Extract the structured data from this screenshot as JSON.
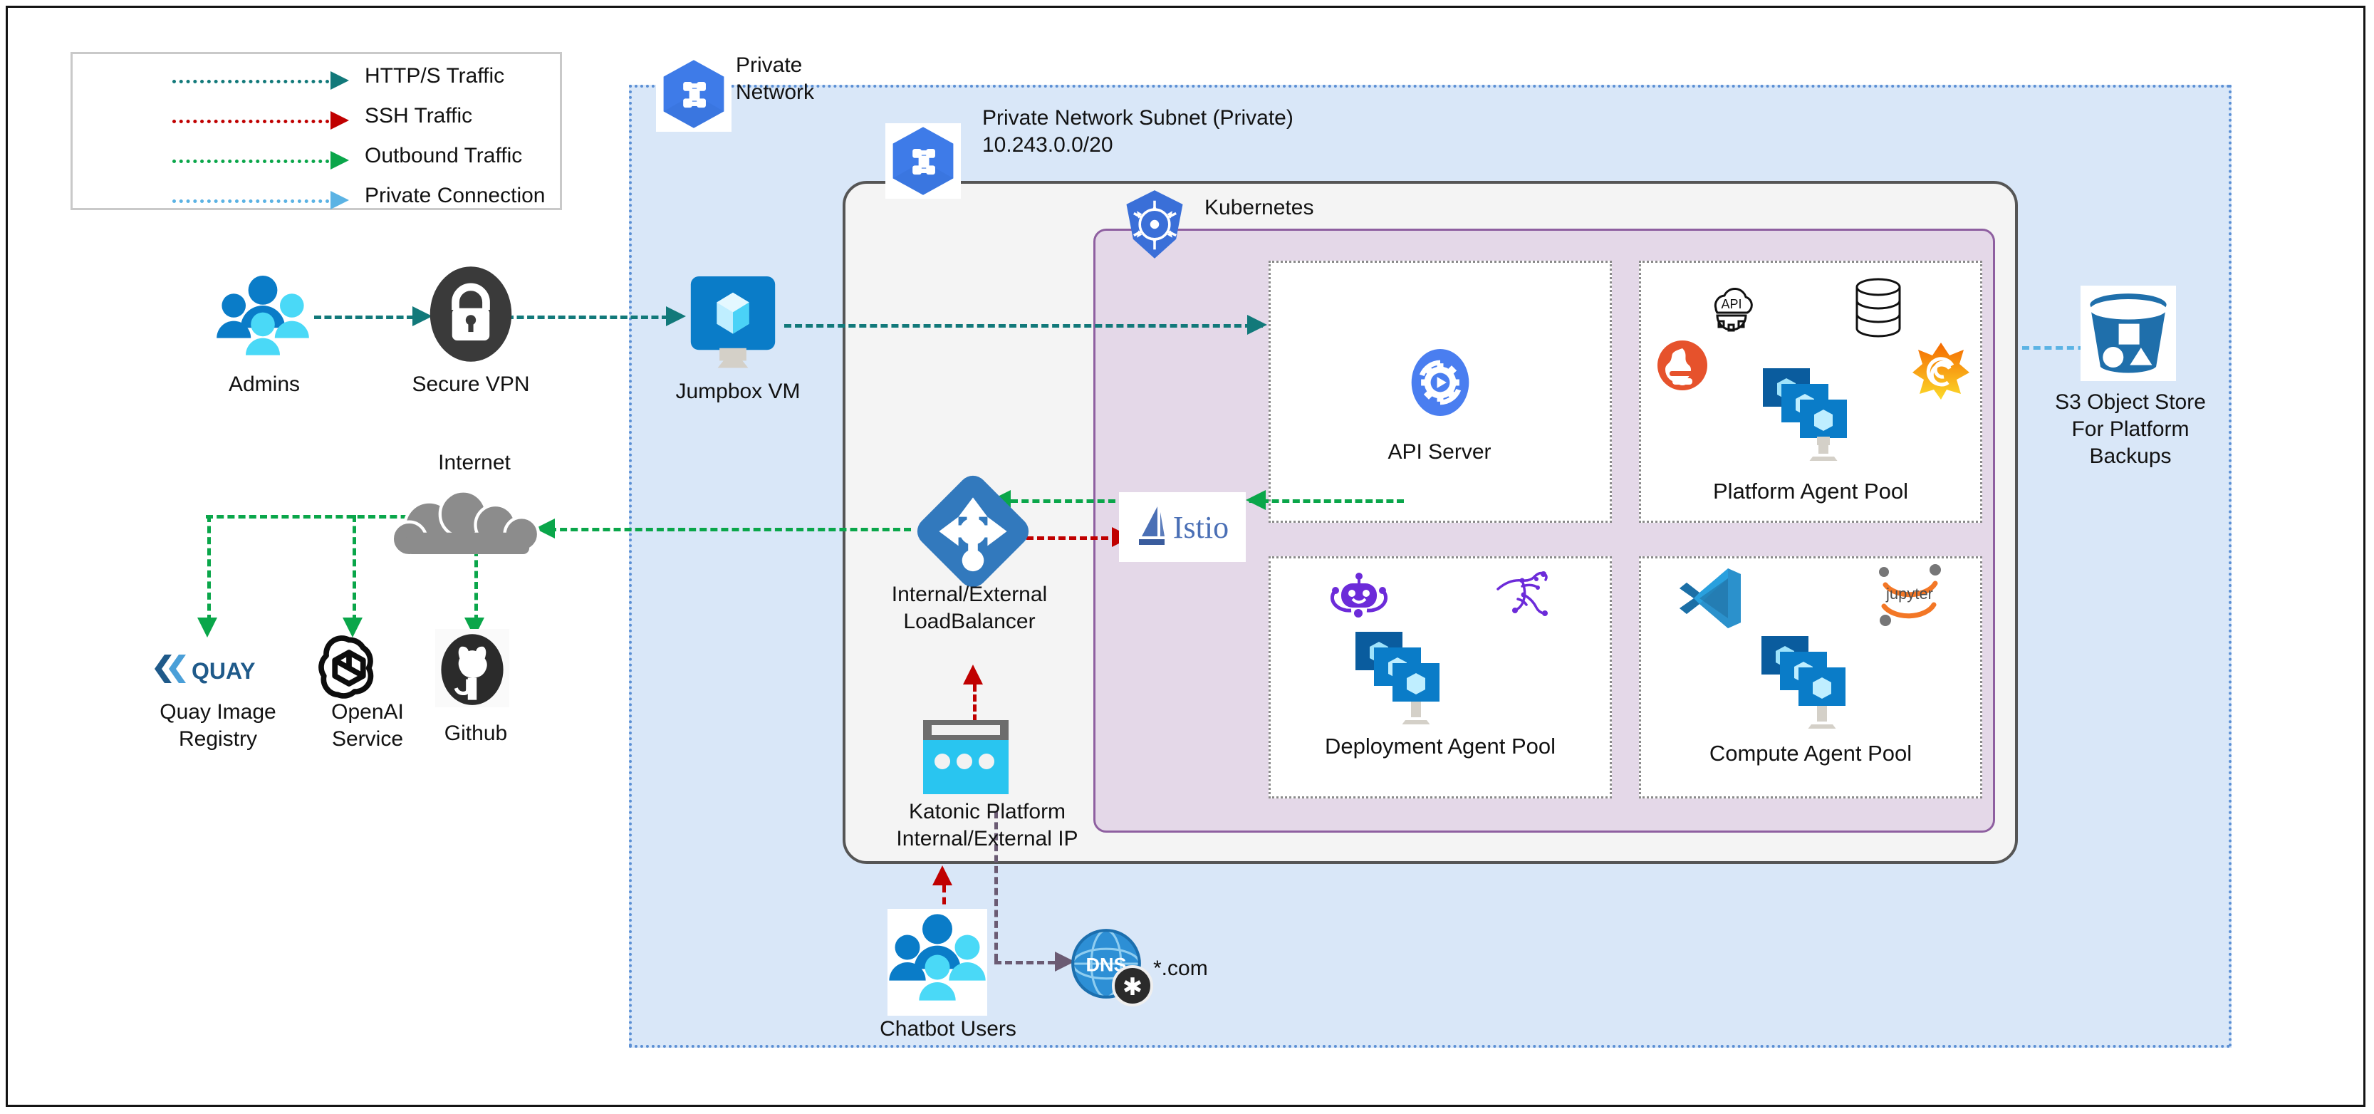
{
  "legend": {
    "items": [
      {
        "label": "HTTP/S Traffic",
        "color": "#12797a",
        "icon": "dashed-arrow-icon"
      },
      {
        "label": "SSH Traffic",
        "color": "#c00000",
        "icon": "dashed-arrow-icon"
      },
      {
        "label": "Outbound Traffic",
        "color": "#0aa64a",
        "icon": "dashed-arrow-icon"
      },
      {
        "label": "Private Connection",
        "color": "#5bb3e4",
        "icon": "dashed-arrow-icon"
      }
    ]
  },
  "containers": {
    "private_network": {
      "label": "Private\nNetwork",
      "icon": "gcp-network-icon",
      "fill": "#d9e7f8",
      "stroke": "#5b8fd4"
    },
    "subnet": {
      "label": "Private Network Subnet (Private)\n10.243.0.0/20",
      "icon": "gcp-network-icon",
      "fill": "#f4f4f4",
      "stroke": "#555555"
    },
    "kubernetes": {
      "label": "Kubernetes",
      "icon": "kubernetes-icon",
      "fill": "#e4d8e8",
      "stroke": "#8e5fa0"
    }
  },
  "nodes": {
    "admins": {
      "label": "Admins",
      "icon": "users-group-icon"
    },
    "secure_vpn": {
      "label": "Secure VPN",
      "icon": "padlock-icon"
    },
    "jumpbox": {
      "label": "Jumpbox VM",
      "icon": "virtual-machine-icon"
    },
    "internet": {
      "label": "Internet",
      "icon": "cloud-icon"
    },
    "quay": {
      "label": "Quay Image\nRegistry",
      "icon": "quay-logo-icon",
      "brand_text": "QUAY",
      "brand_color": "#1f5a8a"
    },
    "openai": {
      "label": "OpenAI\nService",
      "icon": "openai-logo-icon"
    },
    "github": {
      "label": "Github",
      "icon": "github-logo-icon"
    },
    "loadbalancer": {
      "label": "Internal/External\nLoadBalancer",
      "icon": "load-balancer-icon"
    },
    "katonic_ip": {
      "label": "Katonic Platform\nInternal/External IP",
      "icon": "browser-window-icon"
    },
    "chatbot_users": {
      "label": "Chatbot Users",
      "icon": "users-group-icon"
    },
    "dns": {
      "label": "*.com",
      "icon": "dns-globe-icon",
      "badge": "asterisk-icon",
      "badge_glyph": "✱",
      "globe_text": "DNS"
    },
    "istio": {
      "label": "Istio",
      "icon": "istio-sail-icon"
    },
    "api_server": {
      "label": "API Server",
      "icon": "api-server-gear-icon"
    },
    "s3": {
      "label": "S3 Object Store\nFor Platform\nBackups",
      "icon": "s3-bucket-icon"
    }
  },
  "pools": [
    {
      "id": "platform",
      "label": "Platform Agent Pool",
      "icons": [
        "api-cloud-gear-icon",
        "database-cylinder-icon",
        "prometheus-icon",
        "grafana-icon",
        "vm-stack-icon"
      ]
    },
    {
      "id": "deployment",
      "label": "Deployment Agent\nPool",
      "icons": [
        "chatbot-robot-icon",
        "kangaroo-icon",
        "vm-stack-icon"
      ]
    },
    {
      "id": "compute",
      "label": "Compute Agent Pool",
      "icons": [
        "vscode-icon",
        "jupyter-icon",
        "vm-stack-icon"
      ],
      "jupyter_text": "jupyter"
    }
  ],
  "colors": {
    "http": "#12797a",
    "ssh": "#c00000",
    "outbound": "#0aa64a",
    "private": "#5bb3e4",
    "dns_link": "#6b5b73",
    "azure_blue": "#0a7cc8",
    "k8s_blue": "#3a6fd8",
    "purple": "#6c2bd9",
    "prometheus_orange": "#e6522c",
    "grafana_orange": "#f46800"
  }
}
